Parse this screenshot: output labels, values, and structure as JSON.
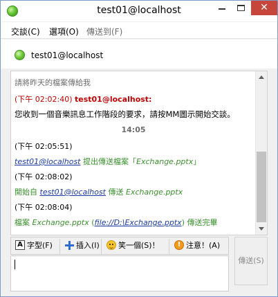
{
  "window": {
    "title": "test01@localhost"
  },
  "menu": {
    "items": [
      {
        "label": "交談(C)"
      },
      {
        "label": "選項(O)"
      },
      {
        "label": "傳送到(F)"
      }
    ]
  },
  "contact": {
    "name": "test01@localhost",
    "status_color": "#74cc3e"
  },
  "chat": {
    "messages": [
      {
        "text": "請將昨天的檔案傳給我"
      },
      {
        "time": "(下午 02:02:40)",
        "sender": "test01@localhost:"
      },
      {
        "text": "您收到一個音樂訊息工作階段的要求，請按MM圖示開始交談。"
      },
      {
        "text": "14:05"
      },
      {
        "time": "(下午 02:05:51)"
      },
      {
        "link": "test01@localhost",
        "text": " 提出傳送檔案「",
        "file": "Exchange.pptx",
        "suffix": "」"
      },
      {
        "time": "(下午 02:08:02)"
      },
      {
        "prefix": "開始自 ",
        "link": "test01@localhost",
        "text": " 傳送 ",
        "file": "Exchange.pptx"
      },
      {
        "time": "(下午 02:08:04)"
      },
      {
        "prefix": "檔案 ",
        "file": "Exchange.pptx",
        "open_paren": " (",
        "link": "file://D:\\Exchange.pptx",
        "close": ")",
        "suffix": " 傳送完畢"
      }
    ]
  },
  "toolbar": {
    "font_label": "字型(F)",
    "insert_label": "插入(I)",
    "smile_label": "笑一個(S)！",
    "attention_label": "注意！(A)"
  },
  "send_label": "傳送(S)",
  "colors": {
    "time_red": "#c00000",
    "system_green": "#3b8f2e",
    "link_blue": "#1b3aa4"
  }
}
